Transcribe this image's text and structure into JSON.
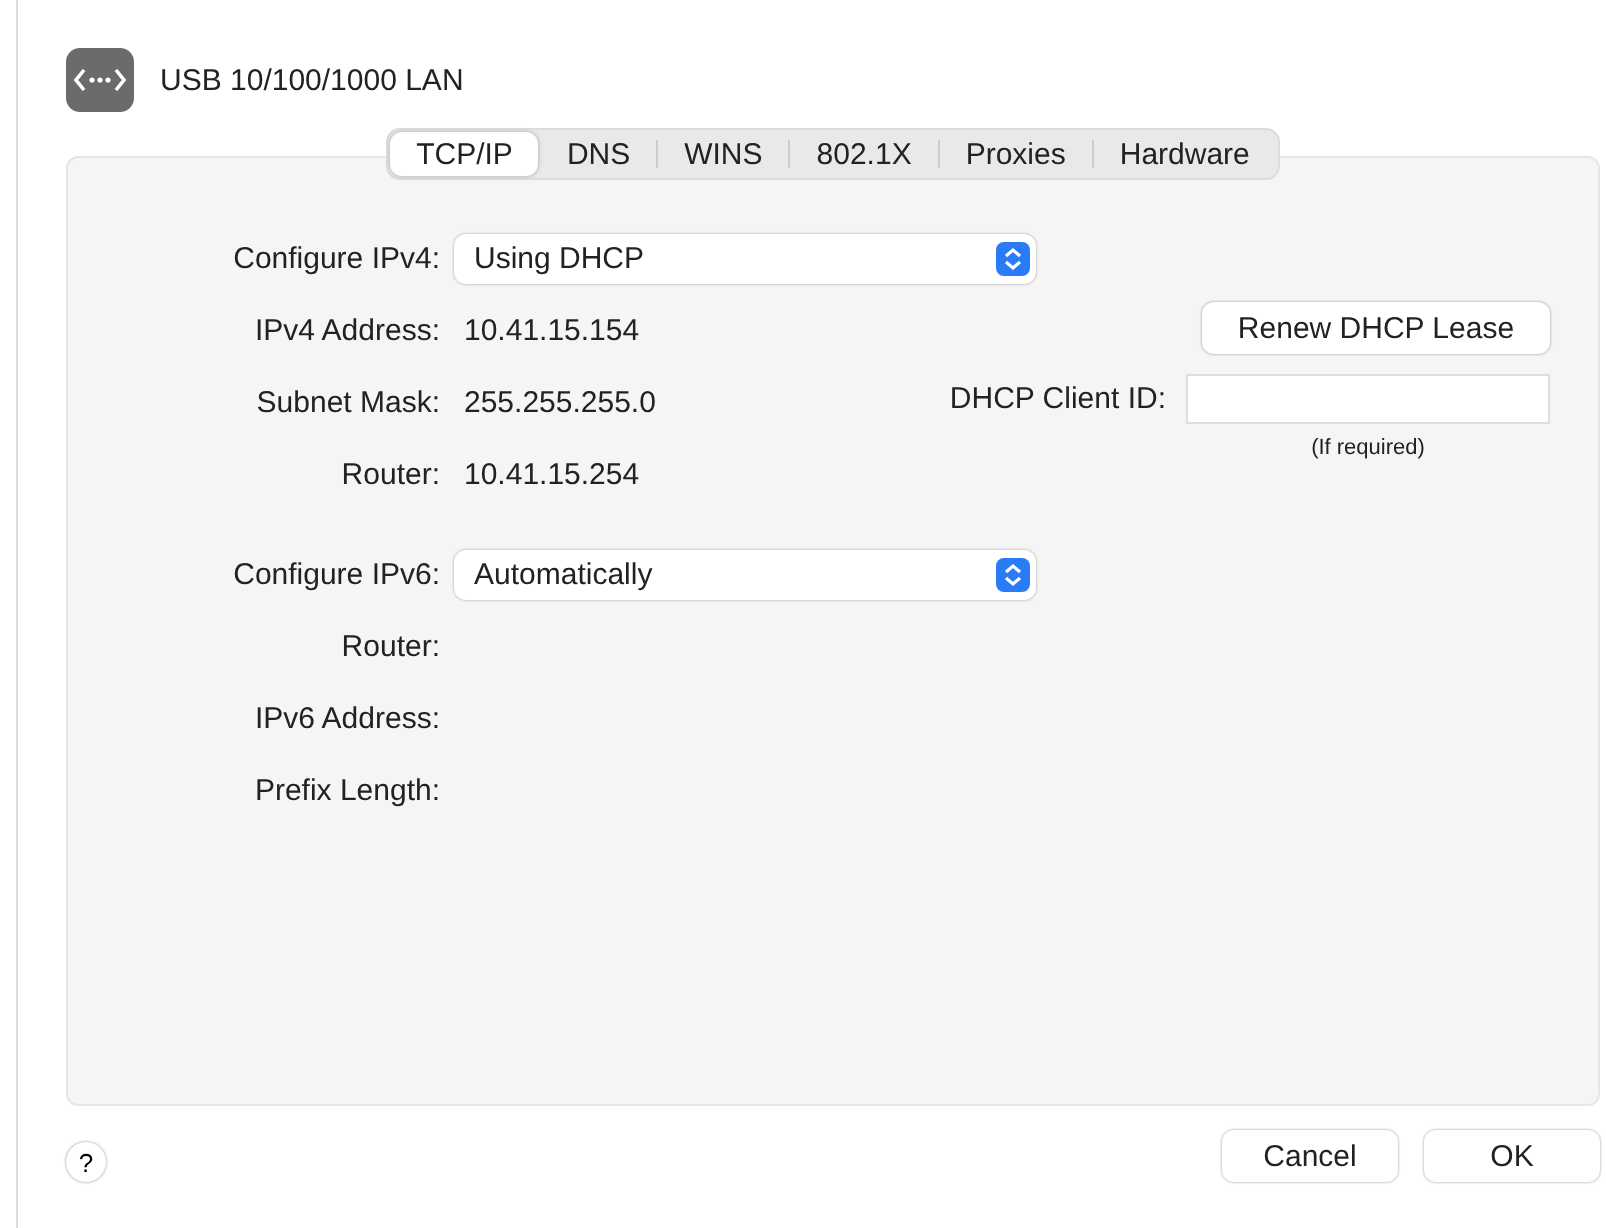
{
  "window": {
    "title": "USB 10/100/1000 LAN"
  },
  "tabs": [
    {
      "label": "TCP/IP",
      "selected": true
    },
    {
      "label": "DNS",
      "selected": false
    },
    {
      "label": "WINS",
      "selected": false
    },
    {
      "label": "802.1X",
      "selected": false
    },
    {
      "label": "Proxies",
      "selected": false
    },
    {
      "label": "Hardware",
      "selected": false
    }
  ],
  "ipv4": {
    "configure_label": "Configure IPv4:",
    "configure_value": "Using DHCP",
    "rows": [
      {
        "label": "IPv4 Address:",
        "value": "10.41.15.154"
      },
      {
        "label": "Subnet Mask:",
        "value": "255.255.255.0"
      },
      {
        "label": "Router:",
        "value": "10.41.15.254"
      }
    ],
    "renew_button": "Renew DHCP Lease",
    "client_id_label": "DHCP Client ID:",
    "client_id_hint": "(If required)"
  },
  "ipv6": {
    "configure_label": "Configure IPv6:",
    "configure_value": "Automatically",
    "rows": [
      {
        "label": "Router:"
      },
      {
        "label": "IPv6 Address:"
      },
      {
        "label": "Prefix Length:"
      }
    ]
  },
  "help_button": "?",
  "buttons": [
    "Cancel",
    "OK"
  ]
}
